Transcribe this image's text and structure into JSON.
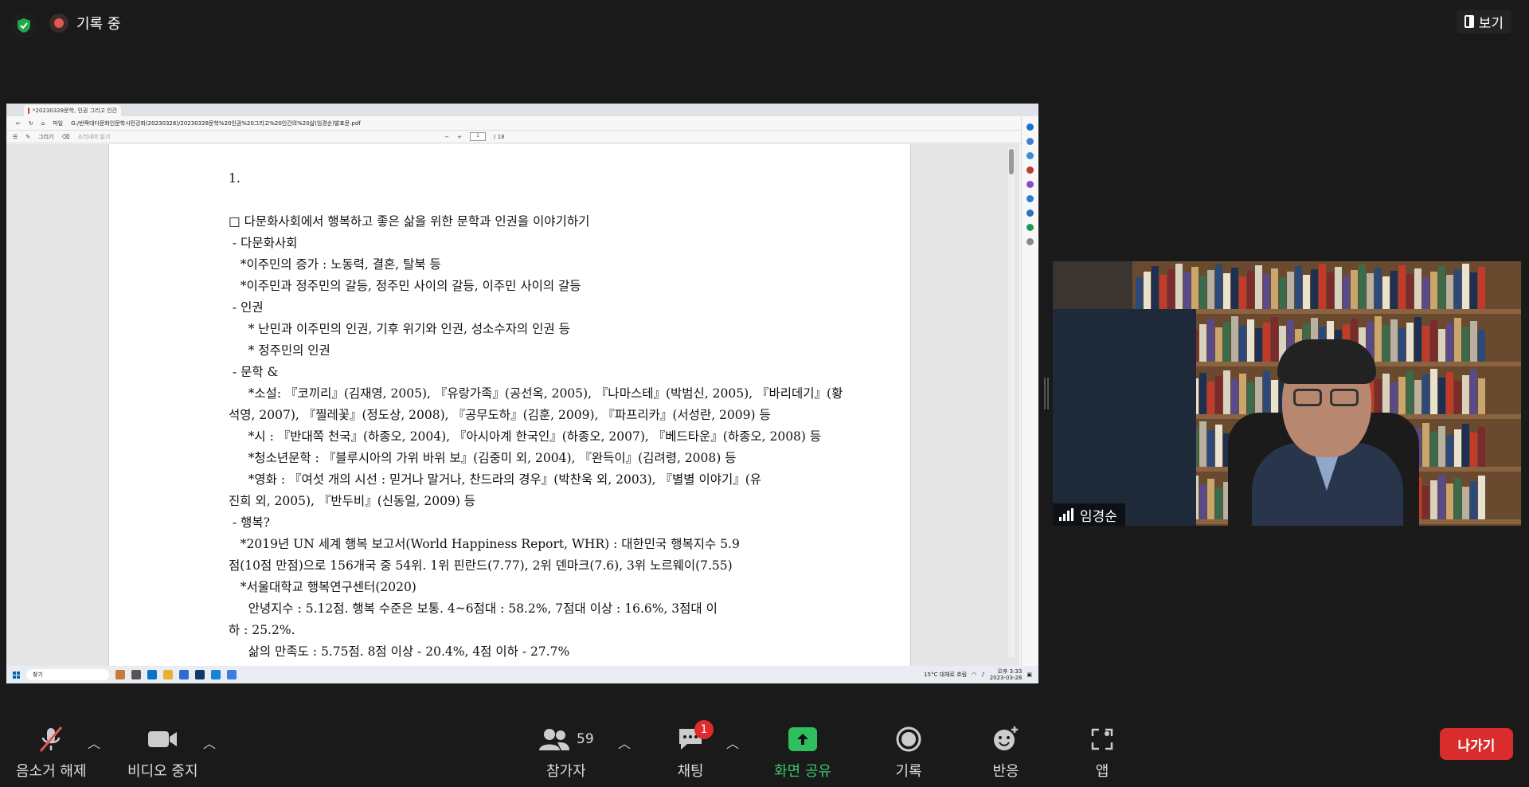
{
  "meeting": {
    "recording_label": "기록 중",
    "view_label": "보기",
    "participant_name": "임경순"
  },
  "browser": {
    "tab_title": "*20230328문학, 인권 그리고 인간",
    "file_label": "파일",
    "url": "G:/반짝대다문화인문학시민강좌(20230328)/20230328문학%20인권%20그리고%20인간의%20삶(임경순)발표문.pdf",
    "draw_label": "그리기",
    "read_aloud_label": "소리내어 읽기",
    "page_current": "1",
    "page_total": "/ 18"
  },
  "document": {
    "lines": [
      "1.",
      "",
      "□ 다문화사회에서 행복하고 좋은 삶을 위한 문학과 인권을 이야기하기",
      " - 다문화사회",
      "   *이주민의 증가 : 노동력, 결혼, 탈북 등",
      "   *이주민과 정주민의 갈등, 정주민 사이의 갈등, 이주민 사이의 갈등",
      " - 인권",
      "     * 난민과 이주민의 인권, 기후 위기와 인권, 성소수자의 인권 등",
      "     * 정주민의 인권",
      " - 문학 &",
      "     *소설: 『코끼리』(김재영, 2005), 『유랑가족』(공선옥, 2005), 『나마스테』(박범신, 2005), 『바리데기』(황",
      "석영, 2007), 『찔레꽃』(정도상, 2008), 『공무도하』(김훈, 2009), 『파프리카』(서성란, 2009) 등",
      "     *시 : 『반대쪽 천국』(하종오, 2004), 『아시아계 한국인』(하종오, 2007), 『베드타운』(하종오, 2008) 등",
      "     *청소년문학 : 『블루시아의 가위 바위 보』(김중미 외, 2004), 『완득이』(김려령, 2008) 등",
      "     *영화 : 『여섯 개의 시선 : 믿거나 말거나, 찬드라의 경우』(박찬욱 외, 2003), 『별별 이야기』(유",
      "진희 외, 2005), 『반두비』(신동일, 2009) 등",
      " - 행복?",
      "   *2019년 UN 세계 행복 보고서(World Happiness Report, WHR) : 대한민국 행복지수 5.9",
      "점(10점 만점)으로 156개국 중 54위. 1위 핀란드(7.77), 2위 덴마크(7.6), 3위 노르웨이(7.55)",
      "   *서울대학교 행복연구센터(2020)",
      "     안녕지수 : 5.12점. 행복 수준은 보통. 4~6점대 : 58.2%, 7점대 이상 : 16.6%, 3점대 이",
      "하 : 25.2%.",
      "     삶의 만족도 : 5.75점. 8점 이상 - 20.4%, 4점 이하 - 27.7%"
    ]
  },
  "taskbar": {
    "search_label": "찾기",
    "weather": "15°C 대체로 흐림",
    "time": "오후 3:33",
    "date": "2023-03-28"
  },
  "toolbar": {
    "unmute_label": "음소거 해제",
    "stop_video_label": "비디오 중지",
    "participants_label": "참가자",
    "participants_count": "59",
    "chat_label": "채팅",
    "chat_badge": "1",
    "share_label": "화면 공유",
    "record_label": "기록",
    "reactions_label": "반응",
    "apps_label": "앱",
    "leave_label": "나가기"
  },
  "colors": {
    "leave": "#d92d2d",
    "share": "#2fbf5f",
    "recording": "#e0584f",
    "badge": "#e02b2b"
  }
}
